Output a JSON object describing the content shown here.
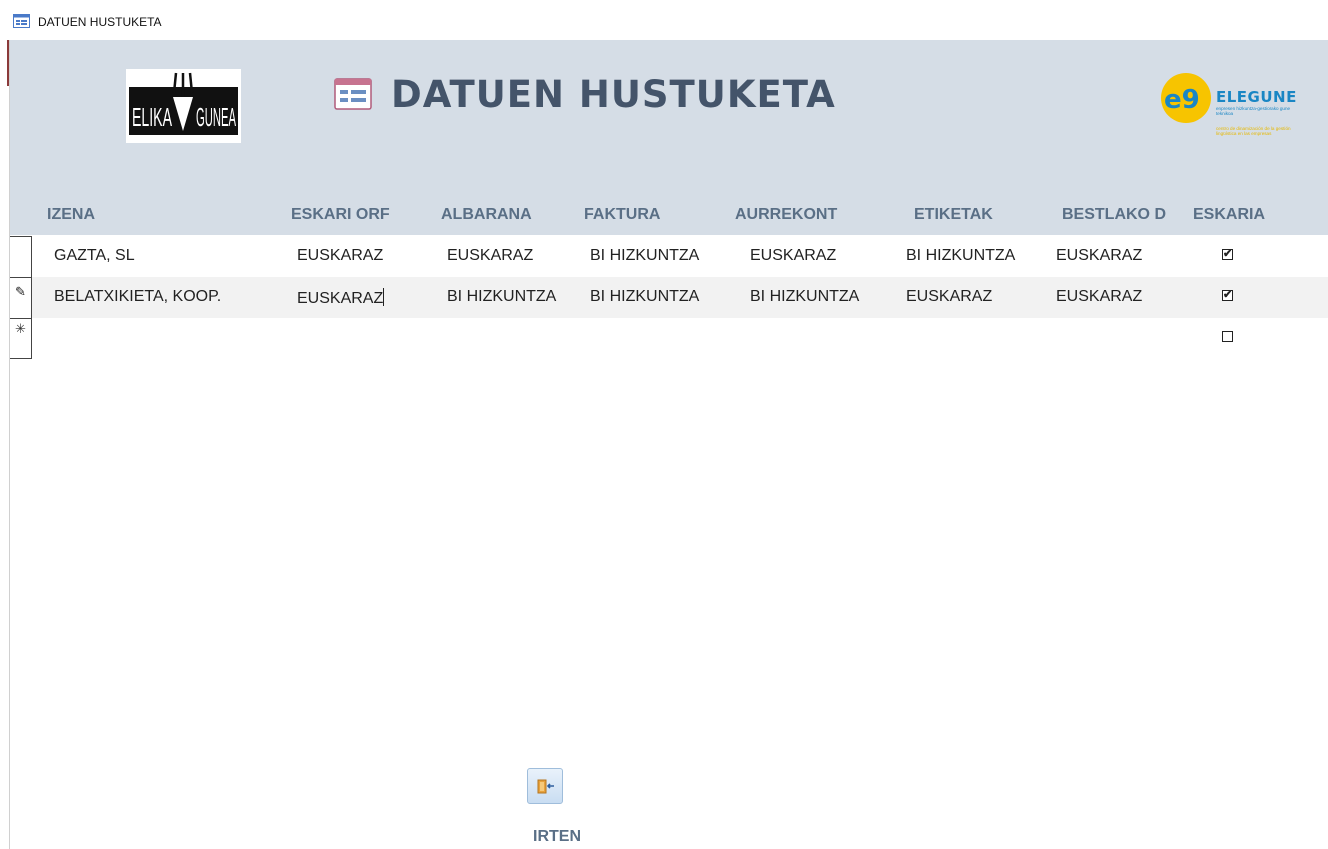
{
  "window": {
    "title": "DATUEN HUSTUKETA"
  },
  "header": {
    "title": "DATUEN HUSTUKETA",
    "logo_left": "ELIKA GUNEA",
    "logo_right": {
      "name": "ELEGUNE",
      "line1": "enpresen hizkuntza-gestiorako gune teknikoa",
      "line2": "centro de dinamización de la gestión lingüística en las empresas"
    }
  },
  "columns": [
    "IZENA",
    "ESKARI ORF",
    "ALBARANA",
    "FAKTURA",
    "AURREKONT",
    "ETIKETAK",
    "BESTLAKO D",
    "ESKARIA"
  ],
  "rows": [
    {
      "izena": "GAZTA, SL",
      "eskari": "EUSKARAZ",
      "albarana": "EUSKARAZ",
      "faktura": "BI HIZKUNTZA",
      "aurrekont": "EUSKARAZ",
      "etiketak": "BI HIZKUNTZA",
      "bestlako": "EUSKARAZ",
      "eskaria": true,
      "eskaria_mark": "✔"
    },
    {
      "izena": "BELATXIKIETA, KOOP.",
      "eskari": "EUSKARAZ",
      "albarana": "BI HIZKUNTZA",
      "faktura": "BI HIZKUNTZA",
      "aurrekont": "BI HIZKUNTZA",
      "etiketak": "EUSKARAZ",
      "bestlako": "EUSKARAZ",
      "eskaria": true,
      "eskaria_mark": "✔"
    }
  ],
  "new_row": {
    "selector_glyph": "✳",
    "eskaria": false
  },
  "edit_glyph": "✎",
  "exit": {
    "label": "IRTEN",
    "icon": "exit-door-icon"
  },
  "colors": {
    "header_bg": "#d5dde6",
    "title": "#44546a",
    "column_header": "#5a6f86",
    "alt_row": "#f2f2f2"
  }
}
